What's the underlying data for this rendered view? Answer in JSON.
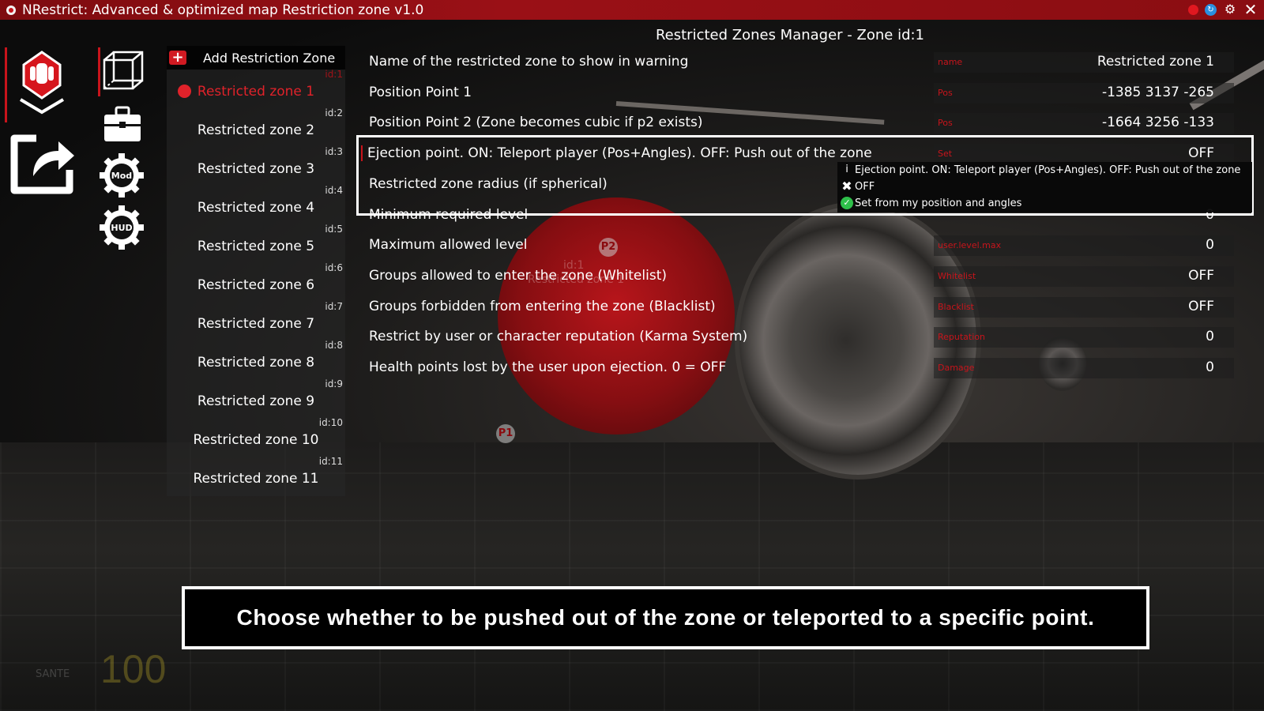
{
  "window": {
    "title": "NRestrict: Advanced & optimized map Restriction zone v1.0",
    "icons": [
      "app-icon",
      "record-icon",
      "refresh-icon",
      "gear-icon",
      "close-icon"
    ]
  },
  "left_panel": {
    "icons": [
      "stop-hand-icon",
      "share-icon",
      "cube-icon",
      "toolbox-icon",
      "mod-gear-icon",
      "hud-gear-icon"
    ],
    "mod_label": "Mod",
    "hud_label": "HUD"
  },
  "zone_list": {
    "add_label": "Add Restriction Zone",
    "items": [
      {
        "id": "id:1",
        "label": "Restricted zone 1",
        "active": true
      },
      {
        "id": "id:2",
        "label": "Restricted zone 2"
      },
      {
        "id": "id:3",
        "label": "Restricted zone 3"
      },
      {
        "id": "id:4",
        "label": "Restricted zone 4"
      },
      {
        "id": "id:5",
        "label": "Restricted zone 5"
      },
      {
        "id": "id:6",
        "label": "Restricted zone 6"
      },
      {
        "id": "id:7",
        "label": "Restricted zone 7"
      },
      {
        "id": "id:8",
        "label": "Restricted zone 8"
      },
      {
        "id": "id:9",
        "label": "Restricted zone 9"
      },
      {
        "id": "id:10",
        "label": "Restricted zone 10"
      },
      {
        "id": "id:11",
        "label": "Restricted zone 11"
      }
    ]
  },
  "manager": {
    "title": "Restricted Zones Manager - Zone id:1",
    "rows": [
      {
        "label": "Name of the restricted zone to show in warning",
        "tag": "name",
        "value": "Restricted zone 1"
      },
      {
        "label": "Position Point 1",
        "tag": "Pos",
        "value": "-1385 3137 -265"
      },
      {
        "label": "Position Point 2 (Zone becomes cubic if p2 exists)",
        "tag": "Pos",
        "value": "-1664 3256 -133"
      },
      {
        "label": "Ejection point. ON: Teleport player (Pos+Angles). OFF: Push out of the zone",
        "tag": "Set",
        "value": "OFF"
      },
      {
        "label": "Restricted zone radius (if spherical)",
        "tag": "",
        "value": ""
      },
      {
        "label": "Minimum required level",
        "tag": "",
        "value": "0"
      },
      {
        "label": "Maximum allowed level",
        "tag": "user.level.max",
        "value": "0"
      },
      {
        "label": "Groups allowed to enter the zone (Whitelist)",
        "tag": "Whitelist",
        "value": "OFF"
      },
      {
        "label": "Groups forbidden from entering the zone (Blacklist)",
        "tag": "Blacklist",
        "value": "OFF"
      },
      {
        "label": "Restrict by user or character reputation (Karma System)",
        "tag": "Reputation",
        "value": "0"
      },
      {
        "label": "Health points lost by the user upon ejection. 0 = OFF",
        "tag": "Damage",
        "value": "0"
      }
    ],
    "dropdown": {
      "info": "Ejection point. ON: Teleport player (Pos+Angles). OFF: Push out of the zone",
      "off": "OFF",
      "set": "Set from my position and angles"
    }
  },
  "scene": {
    "p1": "P1",
    "p2": "P2",
    "ghost_id": "id:1",
    "ghost_name": "Restricted zone 1"
  },
  "banner": "Choose whether to be pushed out of the zone or teleported to a specific point.",
  "hud": {
    "label": "SANTE",
    "value": "100"
  },
  "colors": {
    "accent_red": "#c8141b",
    "titlebar": "#9a1016",
    "check_green": "#2ec04a"
  }
}
